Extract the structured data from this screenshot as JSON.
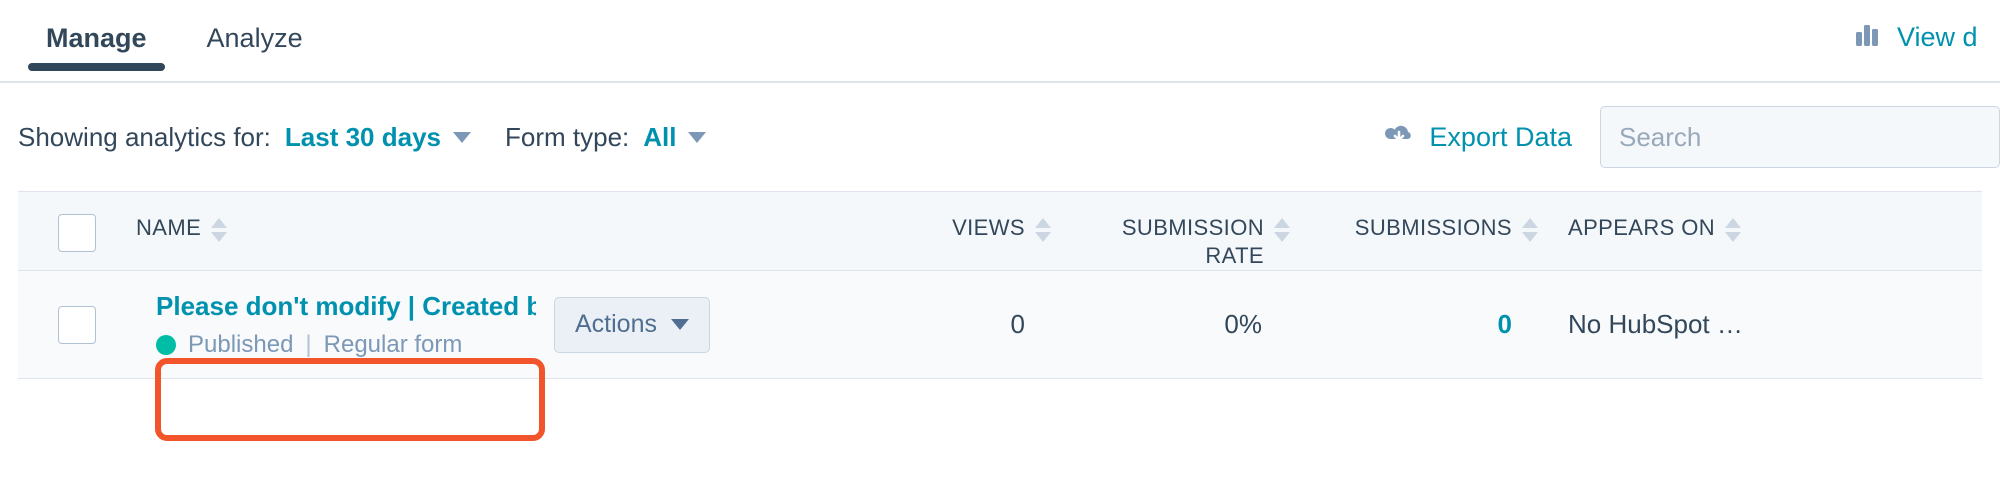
{
  "tabs": [
    {
      "label": "Manage",
      "active": true
    },
    {
      "label": "Analyze",
      "active": false
    }
  ],
  "header": {
    "view_dashboard_label": "View d",
    "view_dashboard_icon": "bar-chart-icon"
  },
  "filters": {
    "analytics_label": "Showing analytics for:",
    "date_range_value": "Last 30 days",
    "form_type_label": "Form type:",
    "form_type_value": "All"
  },
  "toolbar": {
    "export_label": "Export Data",
    "export_icon": "cloud-download-icon",
    "search_placeholder": "Search",
    "search_value": ""
  },
  "table": {
    "columns": [
      {
        "key": "name",
        "label": "NAME",
        "align": "left",
        "sortable": true
      },
      {
        "key": "views",
        "label": "VIEWS",
        "align": "right",
        "sortable": true
      },
      {
        "key": "rate",
        "label": "SUBMISSION RATE",
        "align": "right",
        "sortable": true
      },
      {
        "key": "submissions",
        "label": "SUBMISSIONS",
        "align": "right",
        "sortable": true
      },
      {
        "key": "appears_on",
        "label": "APPEARS ON",
        "align": "left",
        "sortable": true
      }
    ],
    "rows": [
      {
        "title": "Please don't modify | Created by Typ",
        "status": "Published",
        "form_type": "Regular form",
        "separator": "|",
        "actions_label": "Actions",
        "views": "0",
        "submission_rate": "0%",
        "submissions": "0",
        "appears_on": "No HubSpot …"
      }
    ]
  },
  "colors": {
    "accent_teal": "#0091ae",
    "dark_navy": "#33475b",
    "status_green": "#00bda5",
    "highlight_red": "#f2552c",
    "muted_blue": "#7c98b6"
  }
}
